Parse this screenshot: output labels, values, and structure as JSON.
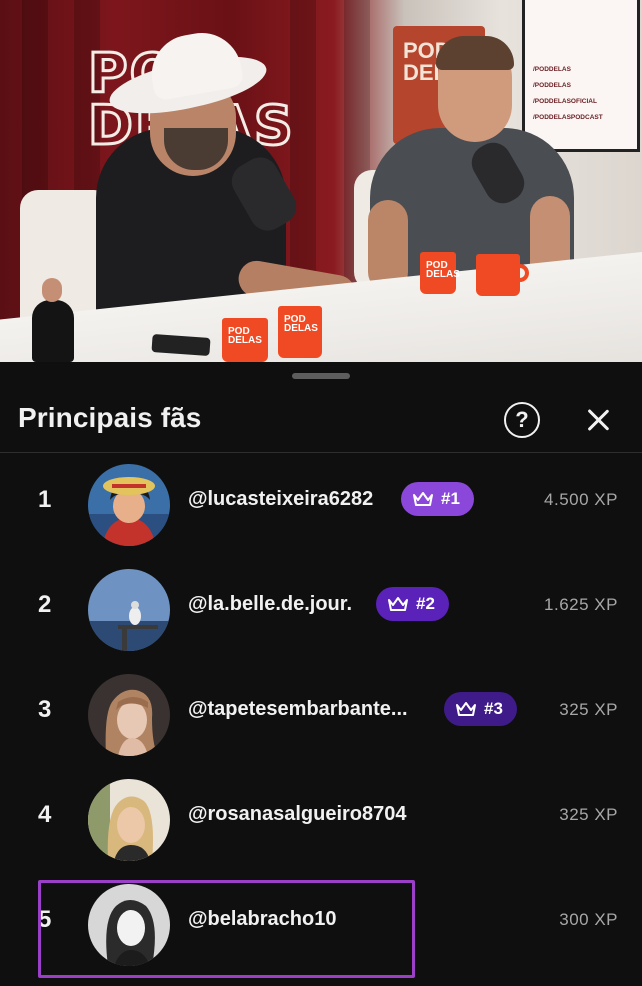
{
  "video": {
    "studio_logo": "POD DELAS",
    "mug_label": "POD DELAS",
    "wall_screen_handles": [
      "/PODDELAS",
      "/PODDELAS",
      "/PODDELASOFICIAL",
      "/PODDELASPODCAST"
    ]
  },
  "sheet": {
    "title": "Principais fãs",
    "help_label": "?",
    "fans": [
      {
        "rank": "1",
        "handle": "@lucasteixeira6282",
        "badge": "#1",
        "xp": "4.500 XP",
        "badge_color": "#8b47d9",
        "avatar_colors": [
          "#3b6fa8",
          "#c4332b",
          "#1a1a1a"
        ]
      },
      {
        "rank": "2",
        "handle": "@la.belle.de.jour.",
        "badge": "#2",
        "xp": "1.625 XP",
        "badge_color": "#5a22b8",
        "avatar_colors": [
          "#6e93c2",
          "#2c4a73",
          "#3a3a3a"
        ]
      },
      {
        "rank": "3",
        "handle": "@tapetesembarbante...",
        "badge": "#3",
        "xp": "325 XP",
        "badge_color": "#3f1b8a",
        "avatar_colors": [
          "#3a3230",
          "#b08462",
          "#e6c8b4"
        ]
      },
      {
        "rank": "4",
        "handle": "@rosanasalgueiro8704",
        "badge": "",
        "xp": "325 XP",
        "badge_color": "",
        "avatar_colors": [
          "#e9e3d8",
          "#d8b87c",
          "#2a2a2a"
        ]
      },
      {
        "rank": "5",
        "handle": "@belabracho10",
        "badge": "",
        "xp": "300 XP",
        "badge_color": "",
        "avatar_colors": [
          "#d7d7d7",
          "#2b2b2b",
          "#f2f2f2"
        ]
      }
    ],
    "highlight_color": "#9b3fc8"
  }
}
